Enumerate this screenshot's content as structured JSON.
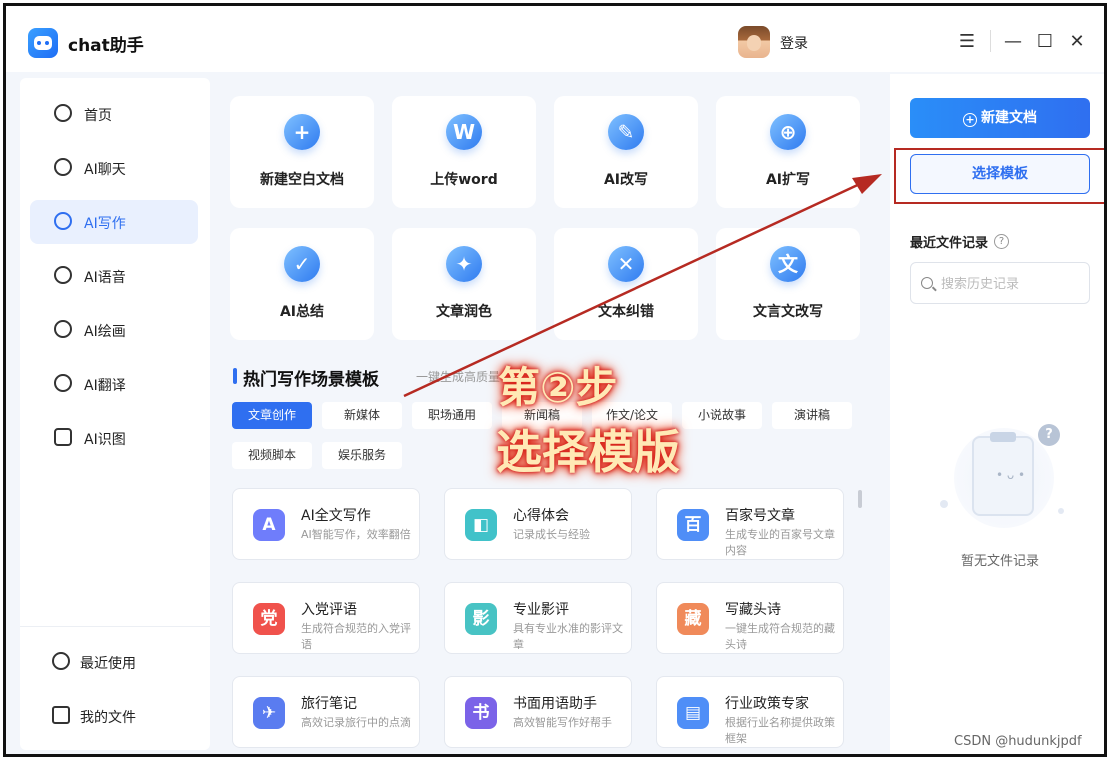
{
  "app": {
    "title": "chat助手",
    "login": "登录"
  },
  "window": {
    "menu_glyph": "☰",
    "min_glyph": "—",
    "max_glyph": "☐",
    "close_glyph": "✕"
  },
  "sidebar": {
    "items": [
      {
        "label": "首页",
        "icon": "home-icon",
        "active": false
      },
      {
        "label": "AI聊天",
        "icon": "chat-icon",
        "active": false
      },
      {
        "label": "AI写作",
        "icon": "pen-icon",
        "active": true
      },
      {
        "label": "AI语音",
        "icon": "voice-icon",
        "active": false
      },
      {
        "label": "AI绘画",
        "icon": "palette-icon",
        "active": false
      },
      {
        "label": "AI翻译",
        "icon": "translate-icon",
        "active": false
      },
      {
        "label": "AI识图",
        "icon": "scan-icon",
        "active": false
      }
    ],
    "bottom": [
      {
        "label": "最近使用",
        "icon": "clock-icon"
      },
      {
        "label": "我的文件",
        "icon": "file-icon"
      }
    ]
  },
  "tools": [
    {
      "label": "新建空白文档",
      "glyph": "+"
    },
    {
      "label": "上传word",
      "glyph": "W"
    },
    {
      "label": "AI改写",
      "glyph": "✎"
    },
    {
      "label": "AI扩写",
      "glyph": "⊕"
    },
    {
      "label": "AI总结",
      "glyph": "✓"
    },
    {
      "label": "文章润色",
      "glyph": "✦"
    },
    {
      "label": "文本纠错",
      "glyph": "✕"
    },
    {
      "label": "文言文改写",
      "glyph": "文"
    }
  ],
  "templates_section": {
    "title": "热门写作场景模板",
    "subtitle": "一键生成高质量",
    "chips": [
      "文章创作",
      "新媒体",
      "职场通用",
      "新闻稿",
      "作文/论文",
      "小说故事",
      "演讲稿",
      "视频脚本",
      "娱乐服务"
    ],
    "cards": [
      {
        "title": "AI全文写作",
        "desc": "AI智能写作，效率翻倍",
        "glyph": "A",
        "color": "#6f7dfb"
      },
      {
        "title": "心得体会",
        "desc": "记录成长与经验",
        "glyph": "◧",
        "color": "#41c2c9"
      },
      {
        "title": "百家号文章",
        "desc": "生成专业的百家号文章内容",
        "glyph": "百",
        "color": "#4f8ef7"
      },
      {
        "title": "入党评语",
        "desc": "生成符合规范的入党评语",
        "glyph": "党",
        "color": "#f0524c"
      },
      {
        "title": "专业影评",
        "desc": "具有专业水准的影评文章",
        "glyph": "影",
        "color": "#48c3c4"
      },
      {
        "title": "写藏头诗",
        "desc": "一键生成符合规范的藏头诗",
        "glyph": "藏",
        "color": "#f08a5a"
      },
      {
        "title": "旅行笔记",
        "desc": "高效记录旅行中的点滴",
        "glyph": "✈",
        "color": "#5a7cf0"
      },
      {
        "title": "书面用语助手",
        "desc": "高效智能写作好帮手",
        "glyph": "书",
        "color": "#7b63e8"
      },
      {
        "title": "行业政策专家",
        "desc": "根据行业名称提供政策框架",
        "glyph": "▤",
        "color": "#4f8ef7"
      }
    ]
  },
  "right_panel": {
    "new_doc": "新建文档",
    "choose_template": "选择模板",
    "recent_title": "最近文件记录",
    "help": "?",
    "search_placeholder": "搜索历史记录",
    "empty_text": "暂无文件记录",
    "empty_glyph": "?"
  },
  "annotation": {
    "line1": "第②步",
    "line2": "选择模版",
    "color": "#b62a22"
  },
  "watermark": "CSDN @hudunkjpdf",
  "colors": {
    "accent": "#2f6ff0",
    "annotation": "#b62a22",
    "background": "#f3f6fb"
  }
}
